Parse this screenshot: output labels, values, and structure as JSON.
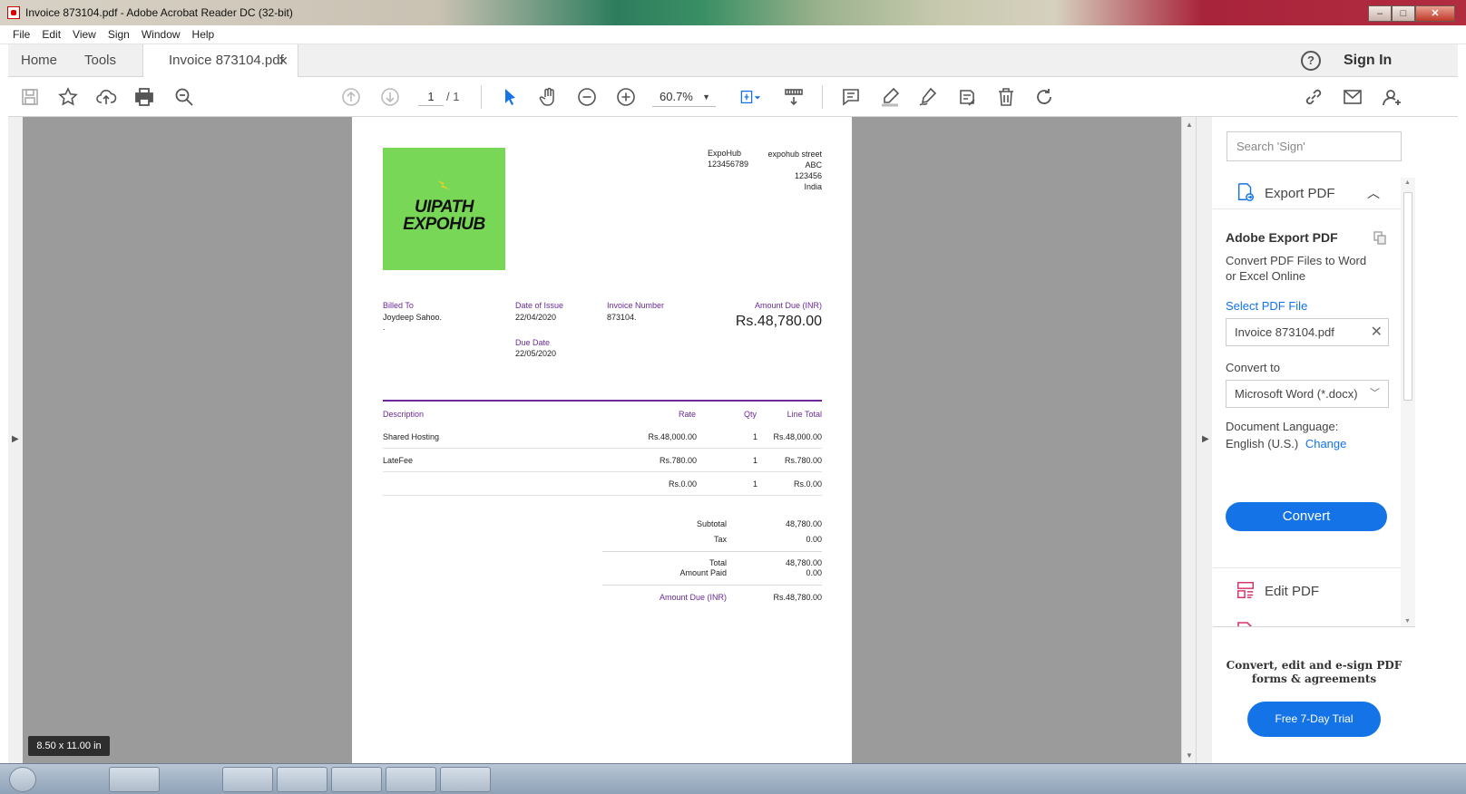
{
  "window": {
    "title": "Invoice 873104.pdf - Adobe Acrobat Reader DC (32-bit)"
  },
  "menu": [
    "File",
    "Edit",
    "View",
    "Sign",
    "Window",
    "Help"
  ],
  "tabs": {
    "home": "Home",
    "tools": "Tools",
    "document": "Invoice 873104.pdf",
    "signin": "Sign In"
  },
  "toolbar": {
    "page_current": "1",
    "page_total": "/ 1",
    "zoom": "60.7%"
  },
  "page_size_badge": "8.50 x 11.00 in",
  "invoice": {
    "logo_line1": "UIPATH",
    "logo_line2": "EXPOHUB",
    "from_name": "ExpoHub",
    "from_phone": "123456789",
    "address": [
      "expohub street",
      "ABC",
      "123456",
      "India"
    ],
    "billed_to_label": "Billed To",
    "billed_to_value": "Joydeep Sahoo.",
    "billed_to_extra": ".",
    "date_issue_label": "Date of Issue",
    "date_issue_value": "22/04/2020",
    "due_date_label": "Due Date",
    "due_date_value": "22/05/2020",
    "invoice_number_label": "Invoice Number",
    "invoice_number_value": "873104.",
    "amount_due_label": "Amount Due (INR)",
    "amount_due_value": "Rs.48,780.00",
    "columns": {
      "description": "Description",
      "rate": "Rate",
      "qty": "Qty",
      "line_total": "Line Total"
    },
    "rows": [
      {
        "description": "Shared Hosting",
        "rate": "Rs.48,000.00",
        "qty": "1",
        "total": "Rs.48,000.00"
      },
      {
        "description": "LateFee",
        "rate": "Rs.780.00",
        "qty": "1",
        "total": "Rs.780.00"
      },
      {
        "description": "",
        "rate": "Rs.0.00",
        "qty": "1",
        "total": "Rs.0.00"
      }
    ],
    "totals": {
      "subtotal_label": "Subtotal",
      "subtotal_value": "48,780.00",
      "tax_label": "Tax",
      "tax_value": "0.00",
      "total_label": "Total",
      "total_value": "48,780.00",
      "paid_label": "Amount Paid",
      "paid_value": "0.00",
      "due_label": "Amount Due (INR)",
      "due_value": "Rs.48,780.00"
    }
  },
  "panel": {
    "search_placeholder": "Search 'Sign'",
    "export_pdf": "Export PDF",
    "adobe_export_title": "Adobe Export PDF",
    "adobe_export_desc": "Convert PDF Files to Word or Excel Online",
    "select_file": "Select PDF File",
    "file_name": "Invoice 873104.pdf",
    "convert_to_label": "Convert to",
    "convert_to_value": "Microsoft Word (*.docx)",
    "doc_lang_label": "Document Language:",
    "doc_lang_value": "English (U.S.)",
    "change": "Change",
    "convert_button": "Convert",
    "edit_pdf": "Edit PDF",
    "promo_text": "Convert, edit and e-sign PDF forms & agreements",
    "trial_button": "Free 7-Day Trial"
  },
  "colors": {
    "accent": "#1473e6",
    "invoice_purple": "#6a2a99",
    "logo_green": "#78d756"
  }
}
